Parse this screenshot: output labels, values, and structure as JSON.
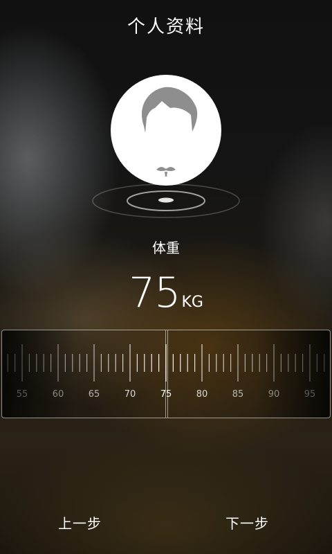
{
  "header": {
    "title": "个人资料"
  },
  "avatar": {
    "icon": "male-avatar-icon",
    "background": "#ffffff",
    "hair_color": "#8e8e8e"
  },
  "field": {
    "label": "体重",
    "value": "75",
    "unit": "KG"
  },
  "ruler": {
    "selected": 75,
    "labels": [
      "55",
      "60",
      "65",
      "70",
      "75",
      "80",
      "85",
      "90",
      "95"
    ]
  },
  "footer": {
    "prev_label": "上一步",
    "next_label": "下一步"
  }
}
